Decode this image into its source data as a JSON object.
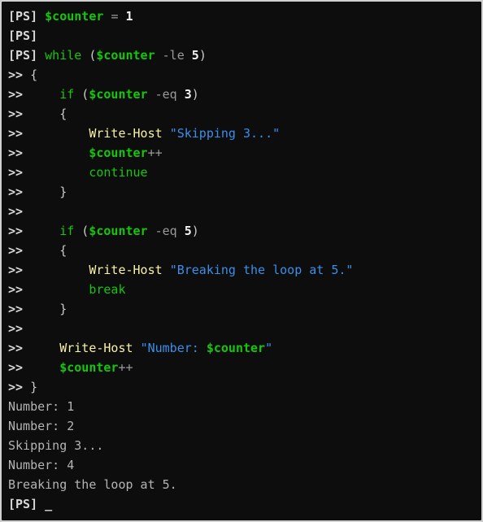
{
  "terminal": {
    "shell": "PowerShell",
    "prompt_label": "[PS]",
    "continuation_prompt": ">>",
    "cursor_glyph": "_",
    "colors": {
      "background": "#0d0d0d",
      "border": "#d0d0d0",
      "keyword": "#16c60c",
      "variable": "#16c60c",
      "cmdlet": "#f9f1a5",
      "string": "#3b8eea",
      "operator": "#9a9a9a",
      "number": "#f2f2f2",
      "output": "#b4b4b4",
      "prompt": "#d8d8d8"
    },
    "lines": [
      {
        "id": "l1",
        "prompt": "[PS]",
        "text": " $counter = 1"
      },
      {
        "id": "l2",
        "prompt": "[PS]",
        "text": ""
      },
      {
        "id": "l3",
        "prompt": "[PS]",
        "text": " while ($counter -le 5)"
      },
      {
        "id": "l4",
        "prompt": ">>",
        "text": " {"
      },
      {
        "id": "l5",
        "prompt": ">>",
        "text": "     if ($counter -eq 3)"
      },
      {
        "id": "l6",
        "prompt": ">>",
        "text": "     {"
      },
      {
        "id": "l7",
        "prompt": ">>",
        "text": "         Write-Host \"Skipping 3...\""
      },
      {
        "id": "l8",
        "prompt": ">>",
        "text": "         $counter++"
      },
      {
        "id": "l9",
        "prompt": ">>",
        "text": "         continue"
      },
      {
        "id": "l10",
        "prompt": ">>",
        "text": "     }"
      },
      {
        "id": "l11",
        "prompt": ">>",
        "text": ""
      },
      {
        "id": "l12",
        "prompt": ">>",
        "text": "     if ($counter -eq 5)"
      },
      {
        "id": "l13",
        "prompt": ">>",
        "text": "     {"
      },
      {
        "id": "l14",
        "prompt": ">>",
        "text": "         Write-Host \"Breaking the loop at 5.\""
      },
      {
        "id": "l15",
        "prompt": ">>",
        "text": "         break"
      },
      {
        "id": "l16",
        "prompt": ">>",
        "text": "     }"
      },
      {
        "id": "l17",
        "prompt": ">>",
        "text": ""
      },
      {
        "id": "l18",
        "prompt": ">>",
        "text": "     Write-Host \"Number: $counter\""
      },
      {
        "id": "l19",
        "prompt": ">>",
        "text": "     $counter++"
      },
      {
        "id": "l20",
        "prompt": ">>",
        "text": " }"
      },
      {
        "id": "l21",
        "prompt": "",
        "text": "Number: 1"
      },
      {
        "id": "l22",
        "prompt": "",
        "text": "Number: 2"
      },
      {
        "id": "l23",
        "prompt": "",
        "text": "Skipping 3..."
      },
      {
        "id": "l24",
        "prompt": "",
        "text": "Number: 4"
      },
      {
        "id": "l25",
        "prompt": "",
        "text": "Breaking the loop at 5."
      },
      {
        "id": "l26",
        "prompt": "[PS]",
        "text": " _"
      }
    ],
    "tokens": {
      "l1": [
        {
          "t": "[PS]",
          "c": "prompt"
        },
        {
          "t": " ",
          "c": "punc"
        },
        {
          "t": "$counter",
          "c": "var"
        },
        {
          "t": " ",
          "c": "punc"
        },
        {
          "t": "=",
          "c": "op"
        },
        {
          "t": " ",
          "c": "punc"
        },
        {
          "t": "1",
          "c": "num"
        }
      ],
      "l2": [
        {
          "t": "[PS]",
          "c": "prompt"
        }
      ],
      "l3": [
        {
          "t": "[PS]",
          "c": "prompt"
        },
        {
          "t": " ",
          "c": "punc"
        },
        {
          "t": "while",
          "c": "kw"
        },
        {
          "t": " (",
          "c": "punc"
        },
        {
          "t": "$counter",
          "c": "var"
        },
        {
          "t": " ",
          "c": "punc"
        },
        {
          "t": "-le",
          "c": "op"
        },
        {
          "t": " ",
          "c": "punc"
        },
        {
          "t": "5",
          "c": "num"
        },
        {
          "t": ")",
          "c": "punc"
        }
      ],
      "l4": [
        {
          "t": ">>",
          "c": "cont"
        },
        {
          "t": " {",
          "c": "punc"
        }
      ],
      "l5": [
        {
          "t": ">>",
          "c": "cont"
        },
        {
          "t": "     ",
          "c": "punc"
        },
        {
          "t": "if",
          "c": "kw"
        },
        {
          "t": " (",
          "c": "punc"
        },
        {
          "t": "$counter",
          "c": "var"
        },
        {
          "t": " ",
          "c": "punc"
        },
        {
          "t": "-eq",
          "c": "op"
        },
        {
          "t": " ",
          "c": "punc"
        },
        {
          "t": "3",
          "c": "num"
        },
        {
          "t": ")",
          "c": "punc"
        }
      ],
      "l6": [
        {
          "t": ">>",
          "c": "cont"
        },
        {
          "t": "     {",
          "c": "punc"
        }
      ],
      "l7": [
        {
          "t": ">>",
          "c": "cont"
        },
        {
          "t": "         ",
          "c": "punc"
        },
        {
          "t": "Write-Host",
          "c": "cmdlet"
        },
        {
          "t": " ",
          "c": "punc"
        },
        {
          "t": "\"Skipping 3...\"",
          "c": "str"
        }
      ],
      "l8": [
        {
          "t": ">>",
          "c": "cont"
        },
        {
          "t": "         ",
          "c": "punc"
        },
        {
          "t": "$counter",
          "c": "var"
        },
        {
          "t": "++",
          "c": "op"
        }
      ],
      "l9": [
        {
          "t": ">>",
          "c": "cont"
        },
        {
          "t": "         ",
          "c": "punc"
        },
        {
          "t": "continue",
          "c": "kw"
        }
      ],
      "l10": [
        {
          "t": ">>",
          "c": "cont"
        },
        {
          "t": "     }",
          "c": "punc"
        }
      ],
      "l11": [
        {
          "t": ">>",
          "c": "cont"
        }
      ],
      "l12": [
        {
          "t": ">>",
          "c": "cont"
        },
        {
          "t": "     ",
          "c": "punc"
        },
        {
          "t": "if",
          "c": "kw"
        },
        {
          "t": " (",
          "c": "punc"
        },
        {
          "t": "$counter",
          "c": "var"
        },
        {
          "t": " ",
          "c": "punc"
        },
        {
          "t": "-eq",
          "c": "op"
        },
        {
          "t": " ",
          "c": "punc"
        },
        {
          "t": "5",
          "c": "num"
        },
        {
          "t": ")",
          "c": "punc"
        }
      ],
      "l13": [
        {
          "t": ">>",
          "c": "cont"
        },
        {
          "t": "     {",
          "c": "punc"
        }
      ],
      "l14": [
        {
          "t": ">>",
          "c": "cont"
        },
        {
          "t": "         ",
          "c": "punc"
        },
        {
          "t": "Write-Host",
          "c": "cmdlet"
        },
        {
          "t": " ",
          "c": "punc"
        },
        {
          "t": "\"Breaking the loop at 5.\"",
          "c": "str"
        }
      ],
      "l15": [
        {
          "t": ">>",
          "c": "cont"
        },
        {
          "t": "         ",
          "c": "punc"
        },
        {
          "t": "break",
          "c": "kw"
        }
      ],
      "l16": [
        {
          "t": ">>",
          "c": "cont"
        },
        {
          "t": "     }",
          "c": "punc"
        }
      ],
      "l17": [
        {
          "t": ">>",
          "c": "cont"
        }
      ],
      "l18": [
        {
          "t": ">>",
          "c": "cont"
        },
        {
          "t": "     ",
          "c": "punc"
        },
        {
          "t": "Write-Host",
          "c": "cmdlet"
        },
        {
          "t": " ",
          "c": "punc"
        },
        {
          "t": "\"Number: ",
          "c": "str"
        },
        {
          "t": "$counter",
          "c": "var"
        },
        {
          "t": "\"",
          "c": "str"
        }
      ],
      "l19": [
        {
          "t": ">>",
          "c": "cont"
        },
        {
          "t": "     ",
          "c": "punc"
        },
        {
          "t": "$counter",
          "c": "var"
        },
        {
          "t": "++",
          "c": "op"
        }
      ],
      "l20": [
        {
          "t": ">>",
          "c": "cont"
        },
        {
          "t": " }",
          "c": "punc"
        }
      ],
      "l21": [
        {
          "t": "Number: 1",
          "c": "out"
        }
      ],
      "l22": [
        {
          "t": "Number: 2",
          "c": "out"
        }
      ],
      "l23": [
        {
          "t": "Skipping 3...",
          "c": "out"
        }
      ],
      "l24": [
        {
          "t": "Number: 4",
          "c": "out"
        }
      ],
      "l25": [
        {
          "t": "Breaking the loop at 5.",
          "c": "out"
        }
      ],
      "l26": [
        {
          "t": "[PS]",
          "c": "prompt"
        },
        {
          "t": " ",
          "c": "punc"
        },
        {
          "t": "_",
          "c": "cursor"
        }
      ]
    }
  }
}
